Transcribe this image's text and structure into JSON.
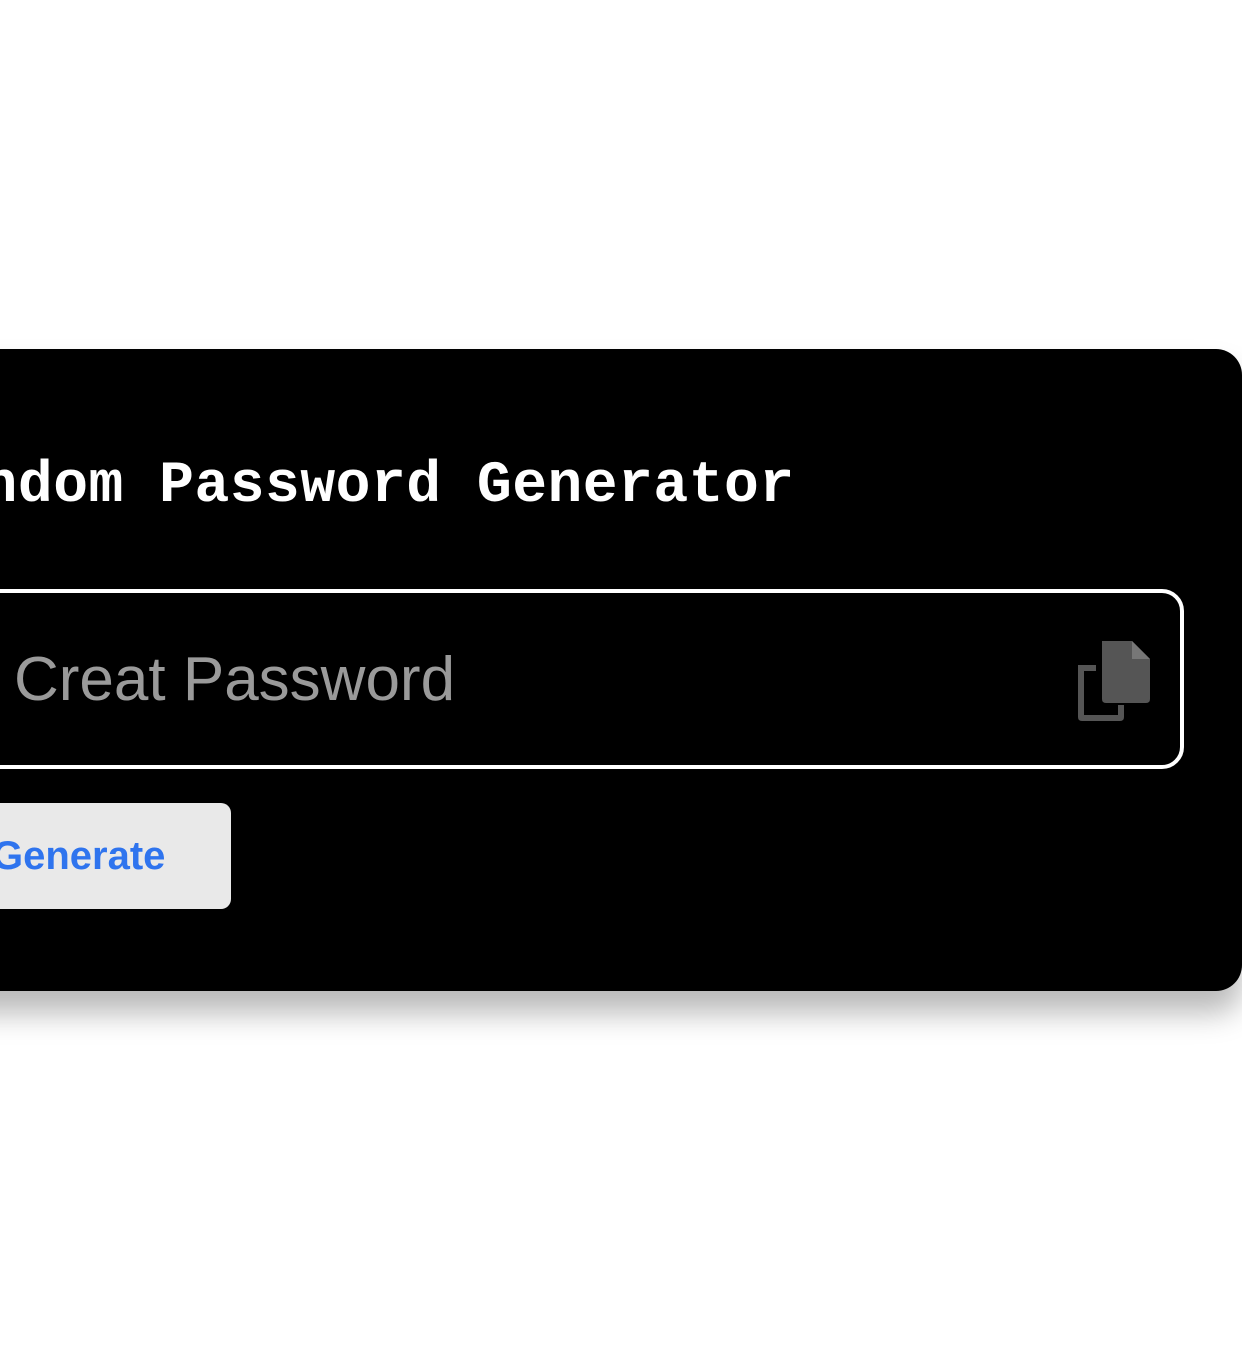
{
  "app": {
    "title": "Random Password Generator"
  },
  "password_field": {
    "value": "",
    "placeholder": "Creat Password"
  },
  "copy_button": {
    "icon": "copy-icon"
  },
  "generate_button": {
    "label": "Generate"
  },
  "colors": {
    "card_background": "#000000",
    "title_text": "#ffffff",
    "field_border": "#ffffff",
    "placeholder_text": "#9a9a9a",
    "copy_icon": "#555555",
    "button_background": "#e9e9e9",
    "button_text": "#2f74ee"
  }
}
